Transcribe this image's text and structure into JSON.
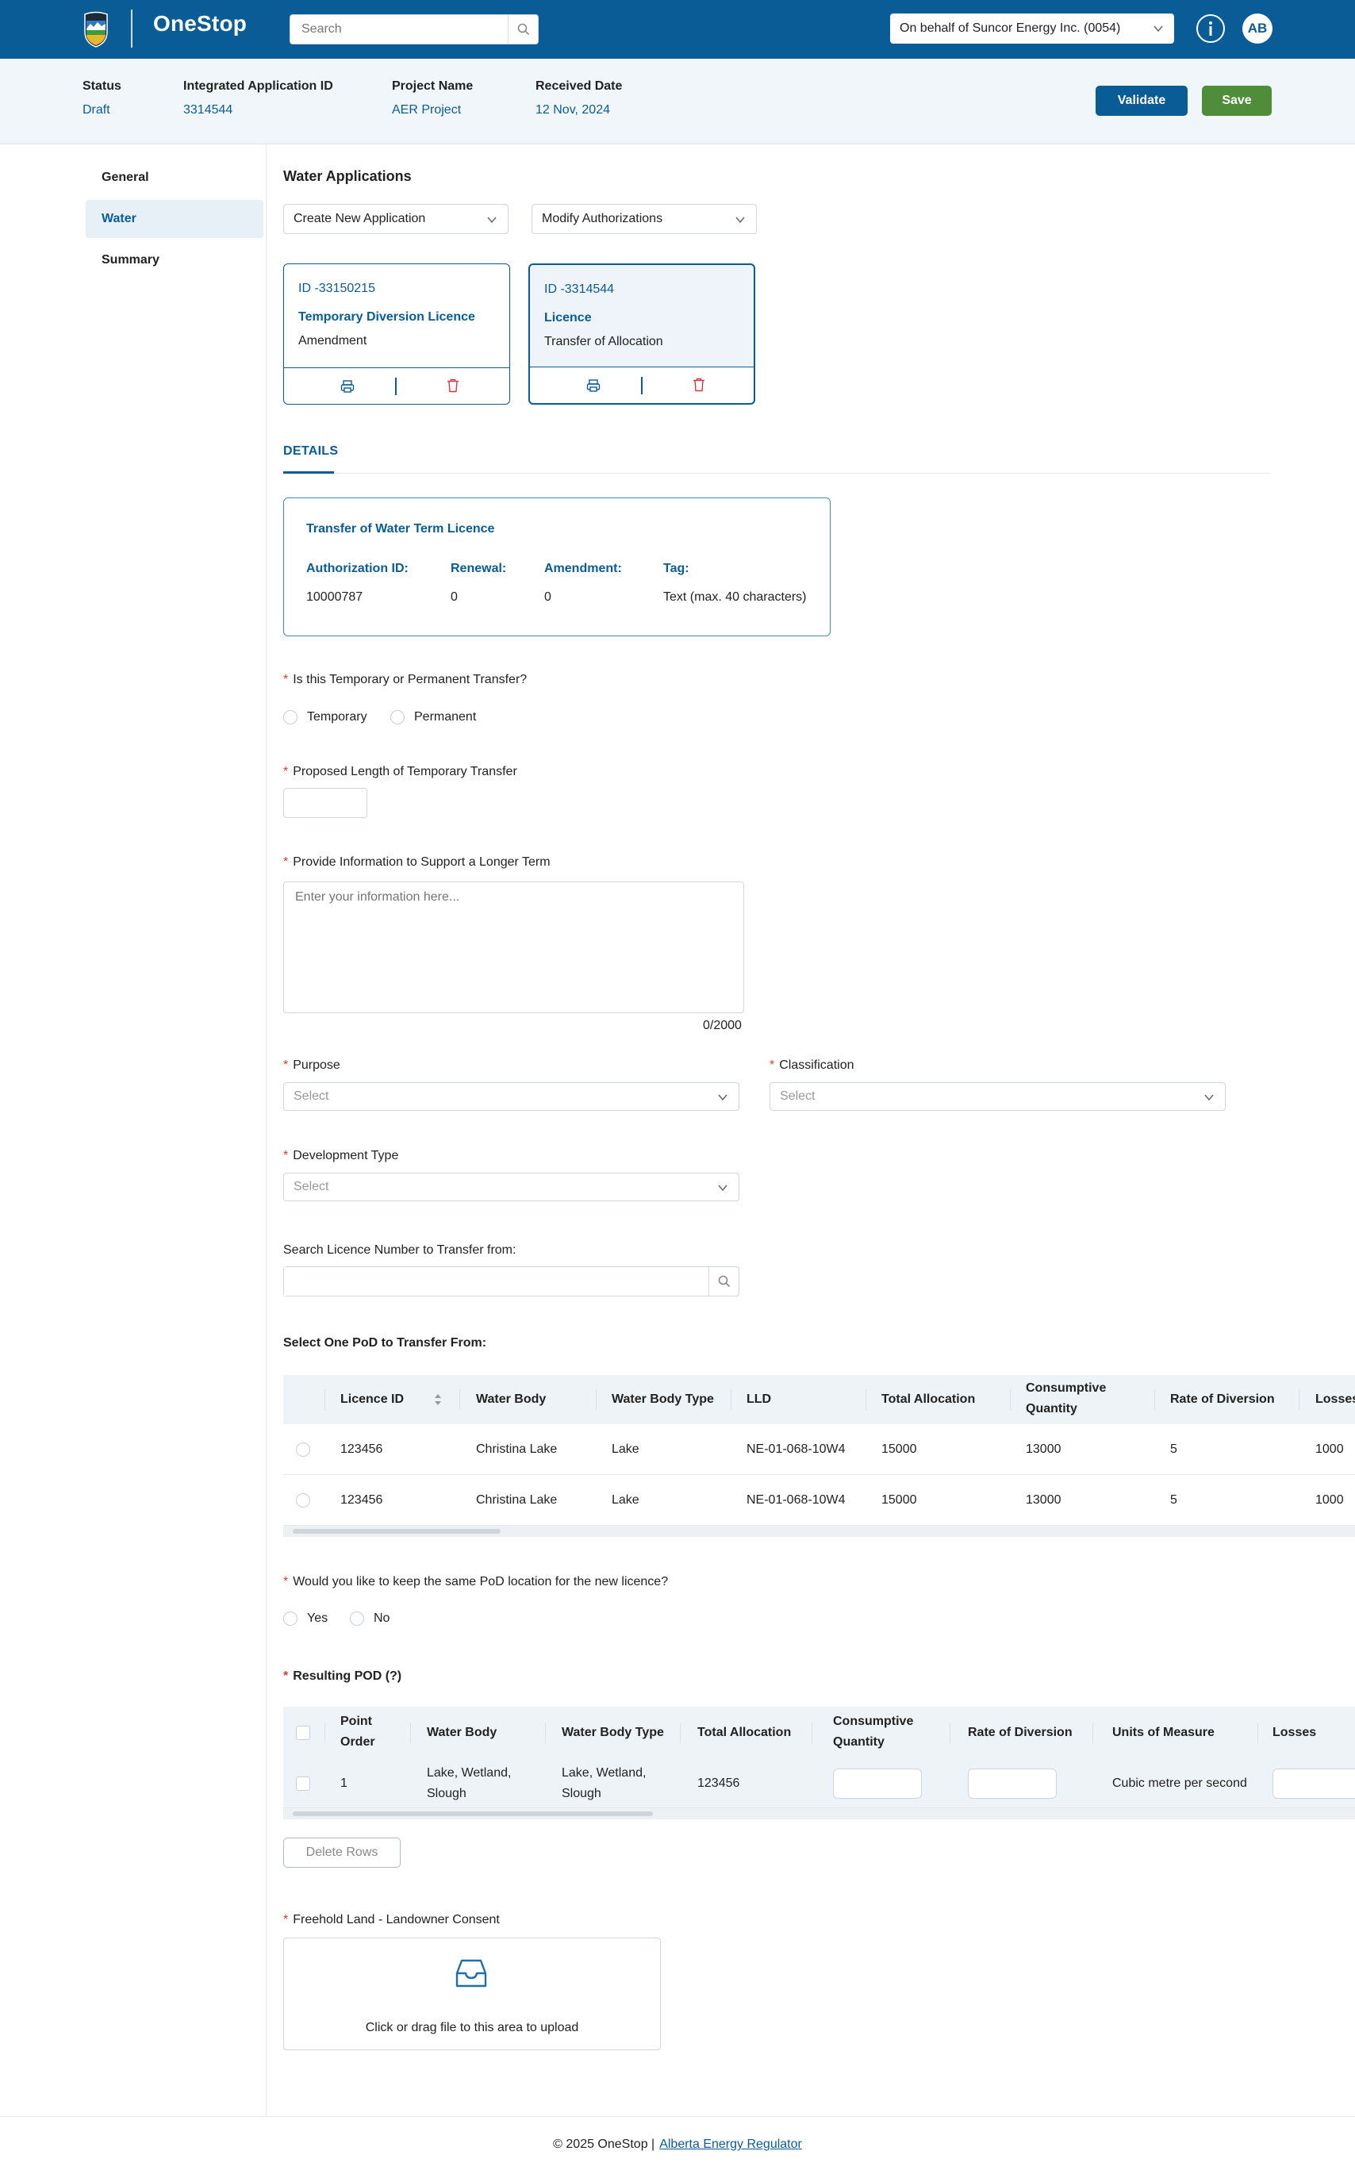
{
  "header": {
    "brand": "OneStop",
    "search_placeholder": "Search",
    "behalf": "On behalf of Suncor Energy Inc. (0054)",
    "avatar": "AB"
  },
  "summary": {
    "status_label": "Status",
    "status_value": "Draft",
    "app_id_label": "Integrated Application ID",
    "app_id_value": "3314544",
    "project_label": "Project Name",
    "project_value": "AER Project",
    "date_label": "Received Date",
    "date_value": "12 Nov, 2024",
    "validate": "Validate",
    "save": "Save"
  },
  "sidebar": {
    "items": [
      {
        "label": "General"
      },
      {
        "label": "Water"
      },
      {
        "label": "Summary"
      }
    ]
  },
  "water": {
    "title": "Water Applications",
    "create": "Create New Application",
    "modify": "Modify Authorizations",
    "cards": [
      {
        "id": "ID -33150215",
        "type": "Temporary Diversion Licence",
        "sub": "Amendment"
      },
      {
        "id": "ID -3314544",
        "type": "Licence",
        "sub": "Transfer  of Allocation"
      }
    ]
  },
  "details": {
    "tab": "DETAILS",
    "title": "Transfer of Water Term Licence",
    "auth_label": "Authorization ID:",
    "auth_value": "10000787",
    "renewal_label": "Renewal:",
    "renewal_value": "0",
    "amend_label": "Amendment:",
    "amend_value": "0",
    "tag_label": "Tag:",
    "tag_value": "Text (max. 40 characters)"
  },
  "form": {
    "q_transfer": "Is this Temporary or Permanent Transfer?",
    "opt_temporary": "Temporary",
    "opt_permanent": "Permanent",
    "q_length": "Proposed Length of Temporary Transfer",
    "q_info": "Provide Information to Support a Longer Term",
    "info_placeholder": "Enter your information here...",
    "counter": "0/2000",
    "purpose": "Purpose",
    "classification": "Classification",
    "development": "Development Type",
    "select": "Select",
    "search_licence": "Search Licence Number to Transfer from:",
    "select_pod": "Select One PoD to Transfer From:",
    "q_same_pod": "Would you like to keep the same PoD location for the new licence?",
    "opt_yes": "Yes",
    "opt_no": "No",
    "resulting_pod": "Resulting POD (?)",
    "delete_rows": "Delete Rows",
    "freehold": "Freehold Land - Landowner Consent",
    "upload_text": "Click or drag file to this area to upload"
  },
  "pod_table": {
    "headers": [
      "Licence ID",
      "Water Body",
      "Water Body Type",
      "LLD",
      "Total Allocation",
      "Consumptive",
      "Quantity",
      "Rate of Diversion",
      "Losses"
    ],
    "rows": [
      [
        "123456",
        "Christina Lake",
        "Lake",
        "NE-01-068-10W4",
        "15000",
        "13000",
        "5",
        "1000"
      ],
      [
        "123456",
        "Christina Lake",
        "Lake",
        "NE-01-068-10W4",
        "15000",
        "13000",
        "5",
        "1000"
      ]
    ]
  },
  "result_table": {
    "headers": [
      "Point",
      "Order",
      "Water Body",
      "Water Body Type",
      "Total Allocation",
      "Consumptive",
      "Quantity",
      "Rate of Diversion",
      "Units of Measure",
      "Losses"
    ],
    "row": {
      "order": "1",
      "water_body_1": "Lake, Wetland,",
      "water_body_2": "Slough",
      "type_1": "Lake, Wetland,",
      "type_2": "Slough",
      "allocation": "123456",
      "units": "Cubic metre per second"
    }
  },
  "footer": {
    "copyright": "© 2025 OneStop |",
    "link": "Alberta Energy Regulator"
  },
  "colors": {
    "primary": "#0a5c97",
    "save": "#4f8d3b",
    "required": "#e03a3a",
    "delete_icon": "#d9363e"
  },
  "icons": [
    "alberta-logo-icon",
    "search-icon",
    "chevron-down-icon",
    "info-icon",
    "print-icon",
    "trash-icon",
    "sort-icon",
    "inbox-upload-icon"
  ]
}
